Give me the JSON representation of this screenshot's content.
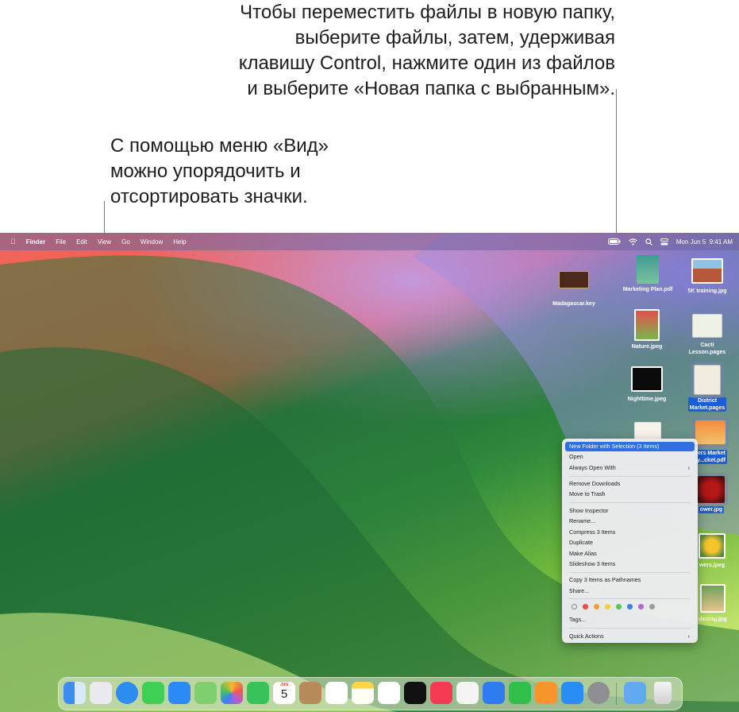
{
  "callouts": {
    "right": [
      "Чтобы переместить файлы в новую папку,",
      "выберите файлы, затем, удерживая",
      "клавишу Control, нажмите один из файлов",
      "и выберите «Новая папка с выбранным»."
    ],
    "left": [
      "С помощью меню «Вид»",
      "можно упорядочить и",
      "отсортировать значки."
    ]
  },
  "menubar": {
    "app": "Finder",
    "items": [
      "File",
      "Edit",
      "View",
      "Go",
      "Window",
      "Help"
    ],
    "clock": "Mon Jun 5  9:41 AM"
  },
  "desktop_icons": [
    {
      "label": "Madagascar.key",
      "icon": "keynote-file-icon"
    },
    {
      "label": "Marketing Plan.pdf",
      "icon": "pdf-file-icon"
    },
    {
      "label": "5K training.jpg",
      "icon": "image-file-icon"
    },
    {
      "label": "Nature.jpeg",
      "icon": "image-file-icon"
    },
    {
      "label": "Cacti Lesson.pages",
      "label_lines": [
        "Cacti",
        "Lesson.pages"
      ],
      "icon": "pages-file-icon"
    },
    {
      "label": "Nighttime.jpeg",
      "icon": "image-file-icon"
    },
    {
      "label": "District Market.pages",
      "label_lines": [
        "District",
        "Market.pages"
      ],
      "icon": "pages-file-icon",
      "selected": true
    },
    {
      "label": "...ers Market ...ly....cket.pdf",
      "label_lines": [
        "ers Market",
        "ly...cket.pdf"
      ],
      "icon": "pdf-file-icon",
      "selected": true
    },
    {
      "label": "...ower.jpg",
      "label_lines": [
        "ower.jpg"
      ],
      "icon": "image-file-icon",
      "selected": true
    },
    {
      "label": "...wers.jpeg",
      "label_lines": [
        "wers.jpeg"
      ],
      "icon": "image-file-icon"
    },
    {
      "label": "...dening.jpg",
      "label_lines": [
        "dening.jpg"
      ],
      "icon": "image-file-icon"
    }
  ],
  "context_menu": {
    "items": [
      {
        "label": "New Folder with Selection (3 Items)",
        "highlighted": true
      },
      {
        "label": "Open"
      },
      {
        "label": "Always Open With",
        "submenu": true
      },
      {
        "label": "Remove Downloads"
      },
      {
        "label": "Move to Trash"
      },
      {
        "label": "Show Inspector"
      },
      {
        "label": "Rename..."
      },
      {
        "label": "Compress 3 Items"
      },
      {
        "label": "Duplicate"
      },
      {
        "label": "Make Alias"
      },
      {
        "label": "Slideshow 3 Items"
      },
      {
        "label": "Copy 3 Items as Pathnames"
      },
      {
        "label": "Share..."
      },
      {
        "label": "Tags..."
      },
      {
        "label": "Quick Actions",
        "submenu": true
      }
    ],
    "tag_colors": [
      "#ffffff",
      "#f04b4b",
      "#f79a36",
      "#f5cf3b",
      "#5ac55a",
      "#3b82f0",
      "#b065d8",
      "#9a9aa0"
    ],
    "chevron": "›"
  },
  "dock": {
    "calendar_month": "JUN",
    "calendar_day": "5",
    "apps": [
      {
        "name": "finder-icon",
        "color": "#3b8df0"
      },
      {
        "name": "launchpad-icon",
        "color": "#e9e9ee"
      },
      {
        "name": "safari-icon",
        "color": "#2d8cf0"
      },
      {
        "name": "messages-icon",
        "color": "#3ecf55"
      },
      {
        "name": "mail-icon",
        "color": "#2b8af5"
      },
      {
        "name": "maps-icon",
        "color": "#7fcf6f"
      },
      {
        "name": "photos-icon",
        "color": "#f4f4f4"
      },
      {
        "name": "facetime-icon",
        "color": "#37c35a"
      },
      {
        "name": "calendar-icon",
        "color": "#ffffff"
      },
      {
        "name": "contacts-icon",
        "color": "#b78a5b"
      },
      {
        "name": "reminders-icon",
        "color": "#ffffff"
      },
      {
        "name": "notes-icon",
        "color": "#fbd64c"
      },
      {
        "name": "freeform-icon",
        "color": "#ffffff"
      },
      {
        "name": "tv-icon",
        "color": "#111111"
      },
      {
        "name": "music-icon",
        "color": "#f53a54"
      },
      {
        "name": "news-icon",
        "color": "#f4f4f4"
      },
      {
        "name": "keynote-icon",
        "color": "#2f7cf0"
      },
      {
        "name": "numbers-icon",
        "color": "#2fbf4a"
      },
      {
        "name": "pages-icon",
        "color": "#f7942e"
      },
      {
        "name": "app-store-icon",
        "color": "#2a8df3"
      },
      {
        "name": "system-settings-icon",
        "color": "#8e8e93"
      },
      {
        "name": "downloads-folder-icon",
        "color": "#63a9f0"
      },
      {
        "name": "trash-icon",
        "color": "#e6e6e6"
      }
    ]
  }
}
